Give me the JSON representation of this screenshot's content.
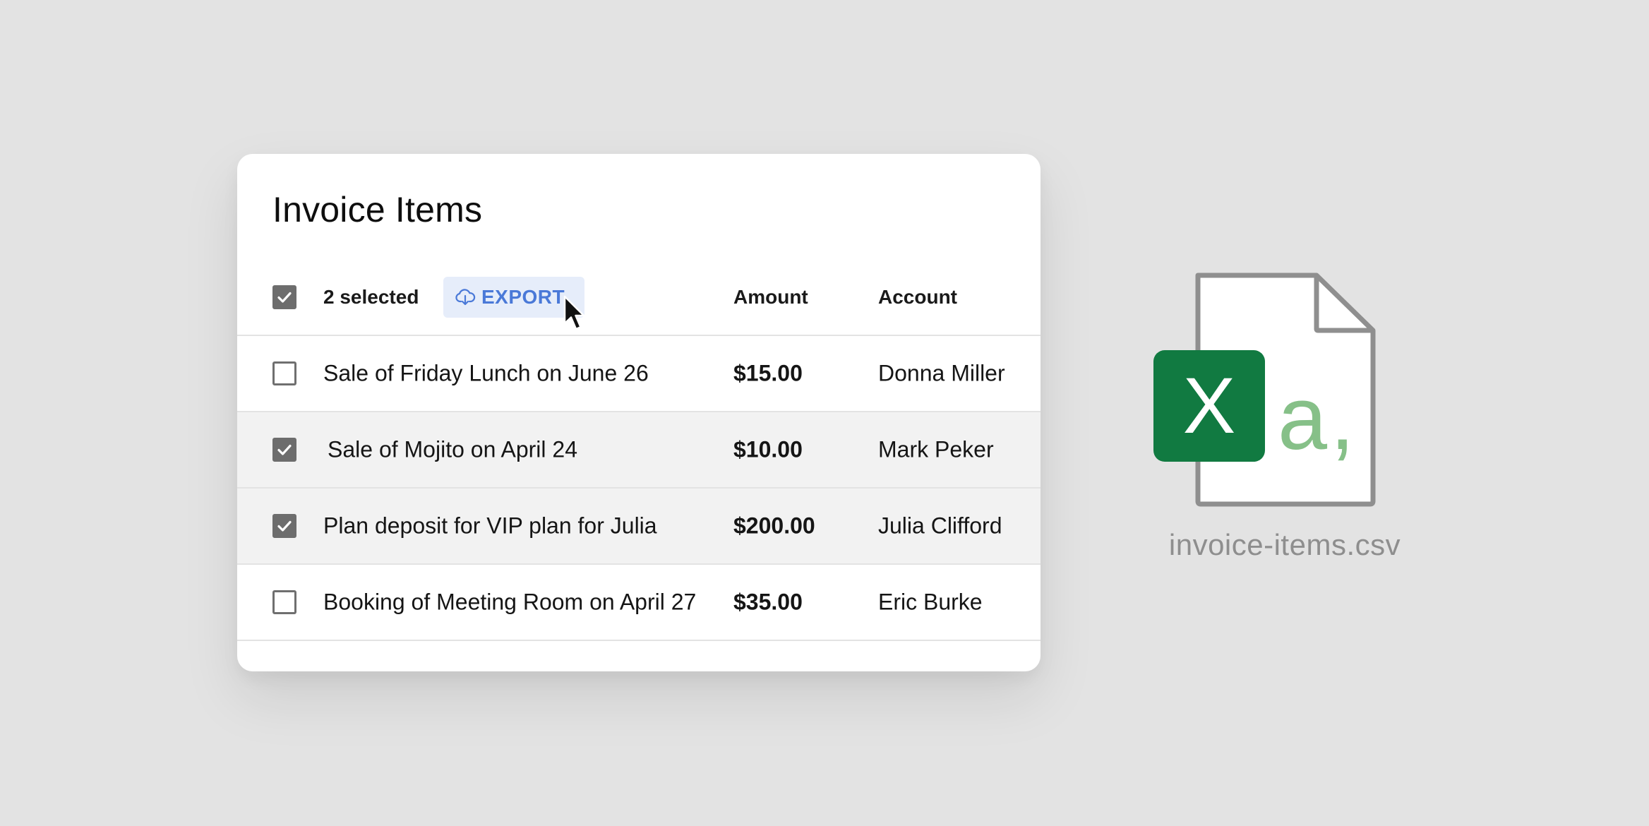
{
  "card": {
    "title": "Invoice Items",
    "header": {
      "selected_count": "2 selected",
      "export_label": "EXPORT",
      "export_icon": "cloud-download-icon",
      "all_checked": true,
      "columns": {
        "amount": "Amount",
        "account": "Account"
      }
    },
    "rows": [
      {
        "description": "Sale of Friday Lunch on June 26",
        "amount": "$15.00",
        "account": "Donna Miller",
        "checked": false
      },
      {
        "description": "Sale of Mojito on April 24",
        "amount": "$10.00",
        "account": "Mark Peker",
        "checked": true
      },
      {
        "description": "Plan deposit for VIP plan for Julia",
        "amount": "$200.00",
        "account": "Julia Clifford",
        "checked": true
      },
      {
        "description": "Booking of Meeting Room on April 27",
        "amount": "$35.00",
        "account": "Eric Burke",
        "checked": false
      }
    ]
  },
  "file": {
    "name": "invoice-items.csv",
    "badge_letter": "X",
    "glyph": "a,",
    "icon": "excel-csv-file-icon"
  },
  "colors": {
    "background": "#e3e3e3",
    "card": "#ffffff",
    "selected_row": "#f2f2f2",
    "checkbox": "#6d6d6d",
    "export_bg": "#e6edfa",
    "export_text": "#4a79d8",
    "excel_green": "#117a41",
    "csv_glyph": "#86c088",
    "file_outline": "#8f8f8f",
    "file_name": "#8e8e8e"
  },
  "cursor": {
    "icon": "mouse-pointer-icon"
  }
}
